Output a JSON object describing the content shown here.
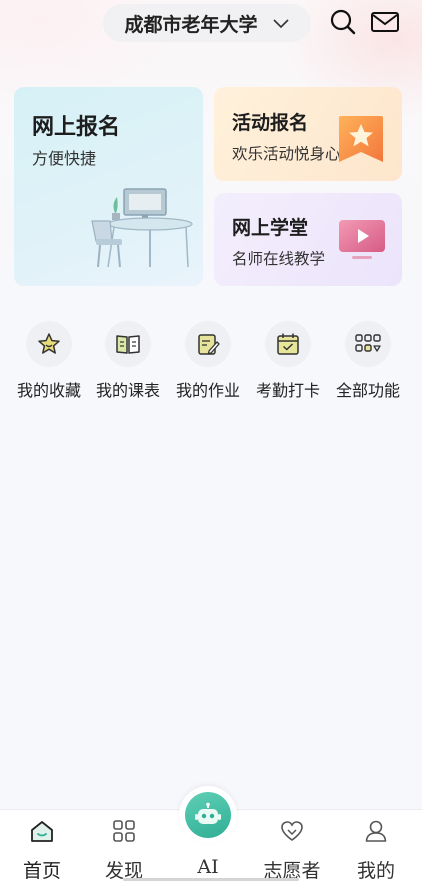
{
  "header": {
    "school_name": "成都市老年大学"
  },
  "cards": {
    "online_signup": {
      "title": "网上报名",
      "subtitle": "方便快捷"
    },
    "activity_signup": {
      "title": "活动报名",
      "subtitle": "欢乐活动悦身心"
    },
    "online_class": {
      "title": "网上学堂",
      "subtitle": "名师在线教学"
    }
  },
  "quick_functions": [
    {
      "label": "我的收藏",
      "icon": "star-icon"
    },
    {
      "label": "我的课表",
      "icon": "book-icon"
    },
    {
      "label": "我的作业",
      "icon": "homework-icon"
    },
    {
      "label": "考勤打卡",
      "icon": "calendar-check-icon"
    },
    {
      "label": "全部功能",
      "icon": "grid-icon"
    }
  ],
  "tabbar": [
    {
      "label": "首页",
      "icon": "home-icon",
      "active": true
    },
    {
      "label": "发现",
      "icon": "discover-icon"
    },
    {
      "label": "AI",
      "icon": "robot-icon"
    },
    {
      "label": "志愿者",
      "icon": "volunteer-heart-icon"
    },
    {
      "label": "我的",
      "icon": "profile-icon"
    }
  ],
  "colors": {
    "accent": "#2fae95",
    "card_blue": "#d6f1f6",
    "card_orange": "#fde6cc",
    "card_purple": "#ece4fb"
  }
}
